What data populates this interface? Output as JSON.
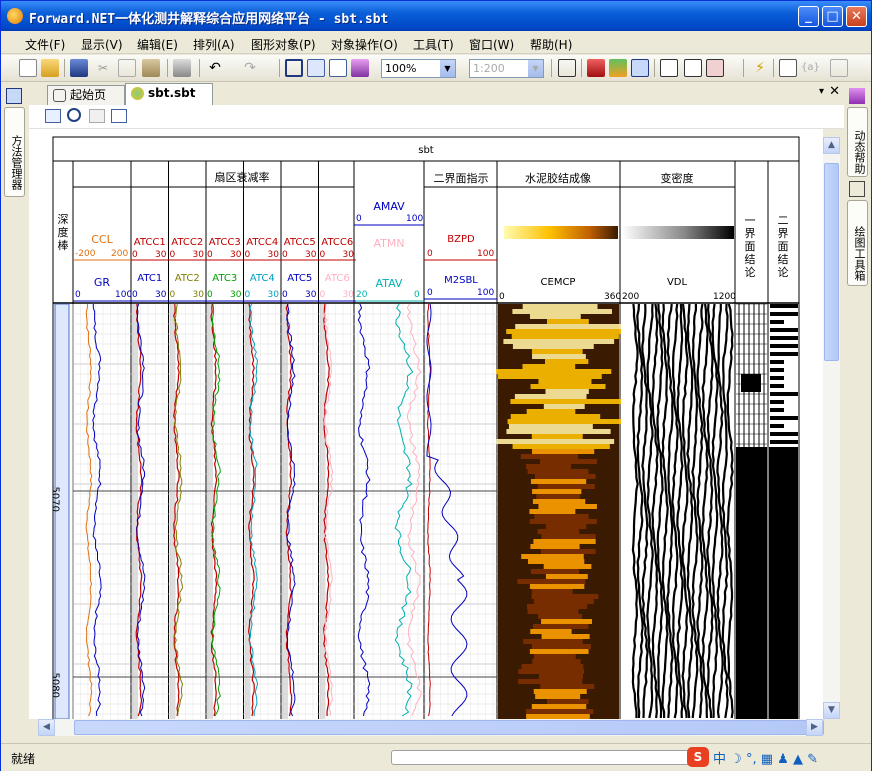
{
  "window": {
    "title": "Forward.NET一体化测井解释综合应用网络平台 - sbt.sbt"
  },
  "menu": [
    "文件(F)",
    "显示(V)",
    "编辑(E)",
    "排列(A)",
    "图形对象(P)",
    "对象操作(O)",
    "工具(T)",
    "窗口(W)",
    "帮助(H)"
  ],
  "toolbar": {
    "zoom": "100%",
    "scale": "1:200"
  },
  "left_panel": {
    "label": "方法管理器"
  },
  "right_panel": {
    "labels": [
      "动态帮助",
      "绘图工具箱"
    ]
  },
  "tabs": [
    {
      "label": "起始页"
    },
    {
      "label": "sbt.sbt"
    }
  ],
  "log": {
    "title": "sbt",
    "depth_track": {
      "label": "深度棒",
      "depths": [
        "5070",
        "5080"
      ]
    },
    "curves1": {
      "top": {
        "name": "CCL",
        "min": "-200",
        "max": "200"
      },
      "bottom": {
        "name": "GR",
        "min": "0",
        "max": "100"
      }
    },
    "sector": {
      "title": "扇区衰减率",
      "cols": [
        {
          "top": "ATCC1",
          "bottom": "ATC1",
          "min": "0",
          "max": "30",
          "topcolor": "#c00000",
          "botcolor": "#0000c0"
        },
        {
          "top": "ATCC2",
          "bottom": "ATC2",
          "min": "0",
          "max": "30",
          "topcolor": "#c00000",
          "botcolor": "#808000"
        },
        {
          "top": "ATCC3",
          "bottom": "ATC3",
          "min": "0",
          "max": "30",
          "topcolor": "#c00000",
          "botcolor": "#00a000"
        },
        {
          "top": "ATCC4",
          "bottom": "ATC4",
          "min": "0",
          "max": "30",
          "topcolor": "#c00000",
          "botcolor": "#00a0c0"
        },
        {
          "top": "ATCC5",
          "bottom": "ATC5",
          "min": "0",
          "max": "30",
          "topcolor": "#c00000",
          "botcolor": "#0000c0"
        },
        {
          "top": "ATCC6",
          "bottom": "ATC6",
          "min": "0",
          "max": "30",
          "topcolor": "#c00000",
          "botcolor": "#ffb0c0"
        }
      ]
    },
    "amp": {
      "c1": {
        "name": "AMAV",
        "min": "0",
        "max": "100"
      },
      "c2": {
        "name": "ATMN"
      },
      "c3": {
        "name": "ATAV",
        "min": "20",
        "max": "0"
      }
    },
    "interface2": {
      "title": "二界面指示",
      "c1": {
        "name": "BZPD",
        "min": "0",
        "max": "100"
      },
      "c2": {
        "name": "M2SBL",
        "min": "0",
        "max": "100"
      }
    },
    "cement": {
      "title": "水泥胶结成像",
      "name": "CEMCP",
      "min": "0",
      "max": "360"
    },
    "vdl": {
      "title": "变密度",
      "name": "VDL",
      "min": "200",
      "max": "1200"
    },
    "concl1": {
      "title": "一界面结论"
    },
    "concl2": {
      "title": "二界面结论"
    }
  },
  "status": {
    "text": "就绪"
  },
  "colors": {
    "titlebar": "#0a5fd8",
    "track_line": "#000000",
    "cemcp_dark": "#3a1a00",
    "cemcp_bright": "#ffc000"
  }
}
